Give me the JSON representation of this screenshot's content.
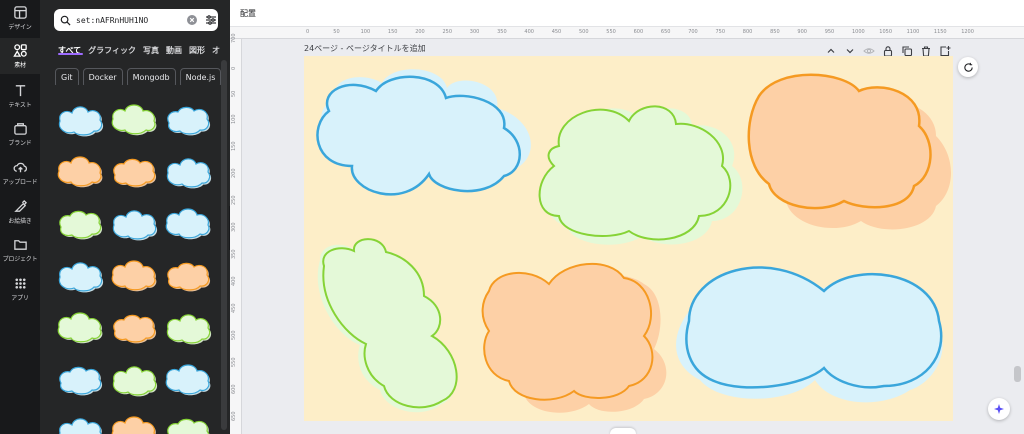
{
  "rail": {
    "items": [
      {
        "label": "デザイン",
        "icon": "layout-icon"
      },
      {
        "label": "素材",
        "icon": "elements-icon"
      },
      {
        "label": "テキスト",
        "icon": "text-icon"
      },
      {
        "label": "ブランド",
        "icon": "brand-icon"
      },
      {
        "label": "アップロード",
        "icon": "upload-icon"
      },
      {
        "label": "お絵描き",
        "icon": "draw-icon"
      },
      {
        "label": "プロジェクト",
        "icon": "folder-icon"
      },
      {
        "label": "アプリ",
        "icon": "apps-icon"
      }
    ]
  },
  "search": {
    "value": "set:nAFRnHUH1NO",
    "placeholder": ""
  },
  "tabs": [
    "すべて",
    "グラフィック",
    "写真",
    "動画",
    "図形",
    "オ"
  ],
  "chips": [
    "Git",
    "Docker",
    "Mongodb",
    "Node.js"
  ],
  "editor": {
    "arrange_label": "配置",
    "page_title": "24ページ - ページタイトルを追加"
  },
  "ruler": {
    "h_ticks": [
      "0",
      "50",
      "100",
      "150",
      "200",
      "250",
      "300",
      "350",
      "400",
      "450",
      "500",
      "550",
      "600",
      "650",
      "700",
      "750",
      "800",
      "850",
      "900",
      "950",
      "1000",
      "1050",
      "1100",
      "1150",
      "1200"
    ],
    "v_ticks": [
      "700",
      "0",
      "50",
      "100",
      "150",
      "200",
      "250",
      "300",
      "350",
      "400",
      "450",
      "500",
      "550",
      "600",
      "650"
    ]
  },
  "colors": {
    "canvas_bg": "#fdeec8",
    "blue_stroke": "#3aa6db",
    "blue_fill": "#d8f2fb",
    "green_stroke": "#86d336",
    "green_fill": "#e4f9d8",
    "orange_stroke": "#f59a22",
    "orange_fill": "#fdd0a6"
  }
}
